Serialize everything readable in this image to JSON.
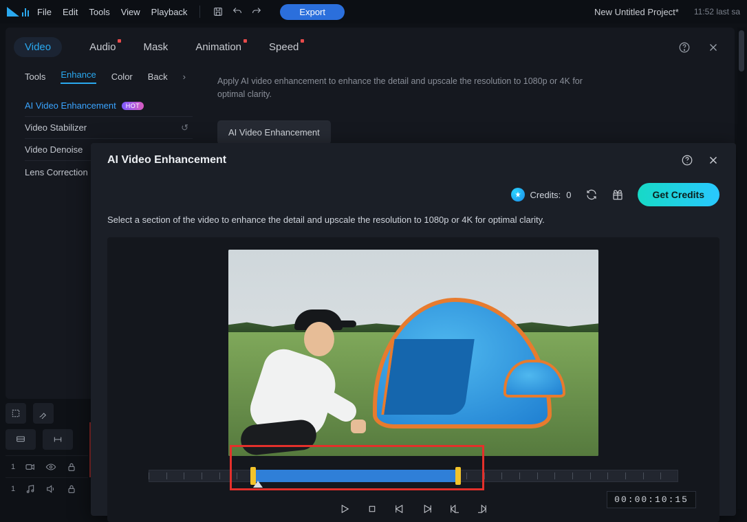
{
  "menu": {
    "file": "File",
    "edit": "Edit",
    "tools": "Tools",
    "view": "View",
    "playback": "Playback",
    "export": "Export"
  },
  "project": {
    "title": "New Untitled Project*",
    "time": "11:52 last sa"
  },
  "tabs": {
    "video": "Video",
    "audio": "Audio",
    "mask": "Mask",
    "animation": "Animation",
    "speed": "Speed"
  },
  "subtabs": {
    "tools": "Tools",
    "enhance": "Enhance",
    "color": "Color",
    "background": "Back"
  },
  "sidelist": {
    "ai": "AI Video Enhancement",
    "hot": "HOT",
    "stab": "Video Stabilizer",
    "denoise": "Video Denoise",
    "lens": "Lens Correction"
  },
  "desc": {
    "text": "Apply AI video enhancement to enhance the detail and upscale the resolution to 1080p or 4K for optimal clarity.",
    "btn": "AI Video Enhancement"
  },
  "modal": {
    "title": "AI Video Enhancement",
    "credits_label": "Credits:",
    "credits_value": "0",
    "get_credits": "Get Credits",
    "instruction": "Select a section of the video to enhance the detail and upscale the resolution to 1080p or 4K for optimal clarity.",
    "timecode": "00:00:10:15"
  },
  "tracks": {
    "idx": "1"
  }
}
